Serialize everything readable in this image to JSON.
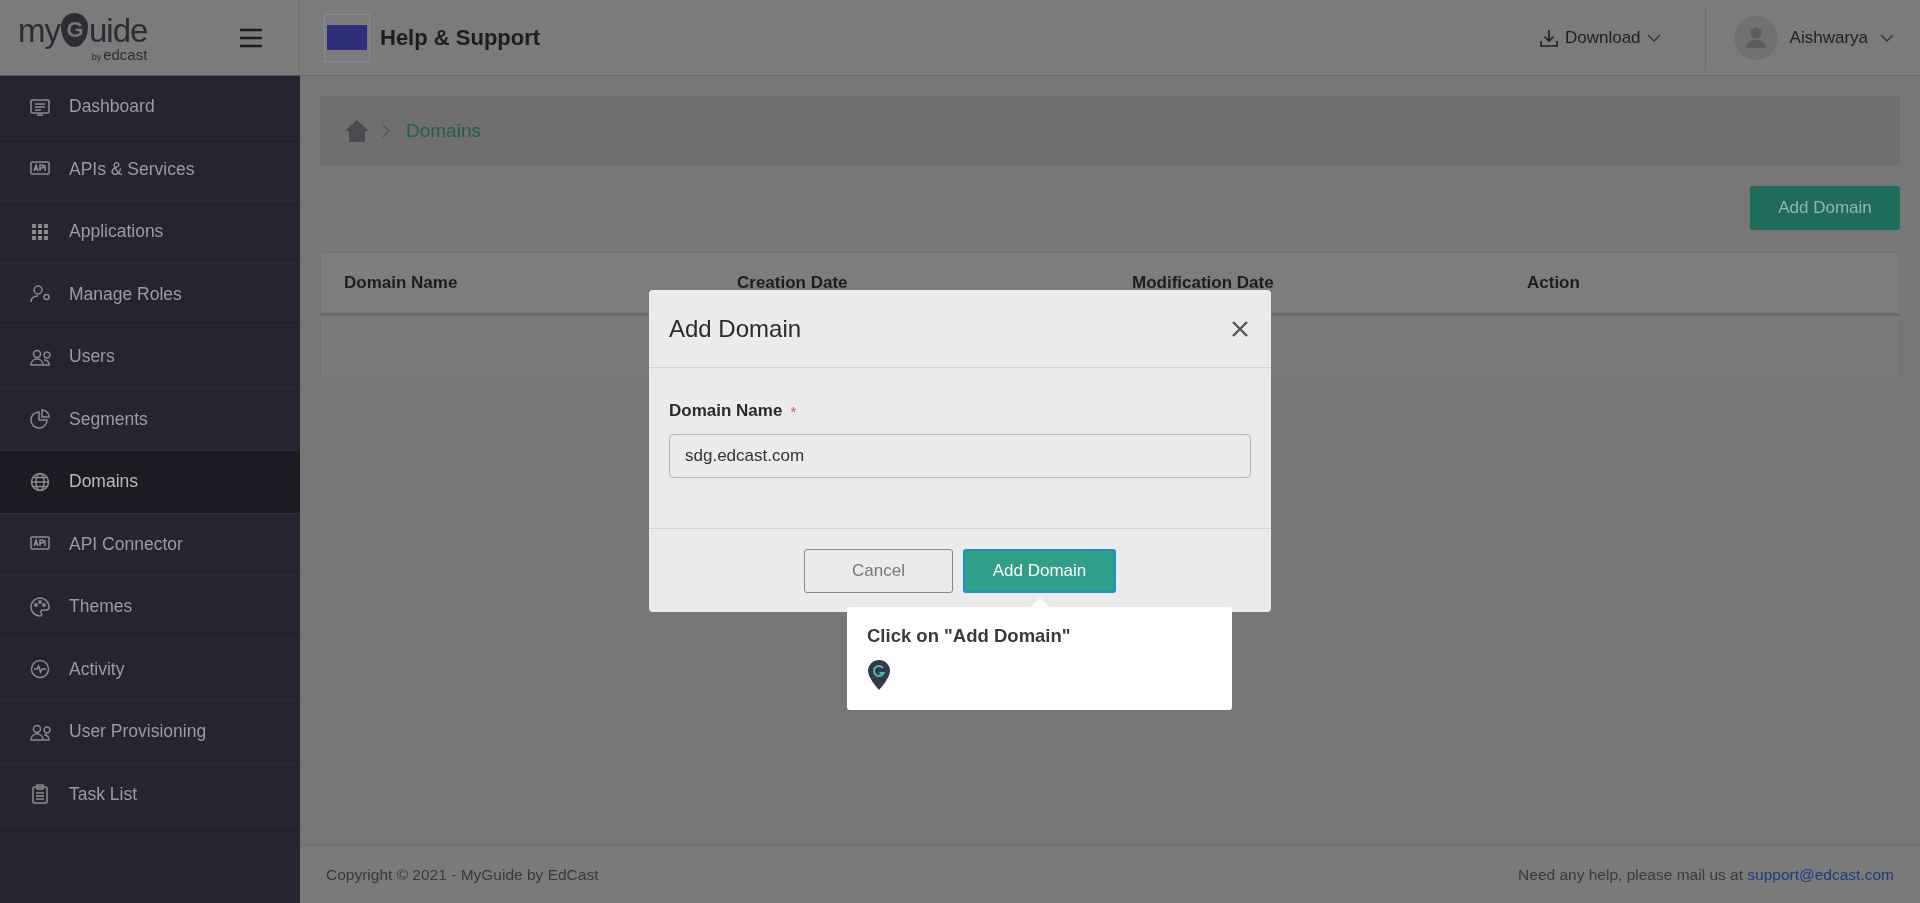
{
  "logo": {
    "prefix": "my",
    "pin_letter": "G",
    "suffix": "uide",
    "by": "by",
    "brand": "edcast"
  },
  "header": {
    "title": "Help & Support",
    "download": "Download",
    "user": "Aishwarya"
  },
  "sidebar": {
    "items": [
      {
        "label": "Dashboard",
        "selected": false
      },
      {
        "label": "APIs & Services",
        "selected": false
      },
      {
        "label": "Applications",
        "selected": false
      },
      {
        "label": "Manage Roles",
        "selected": false
      },
      {
        "label": "Users",
        "selected": false
      },
      {
        "label": "Segments",
        "selected": false
      },
      {
        "label": "Domains",
        "selected": true
      },
      {
        "label": "API Connector",
        "selected": false
      },
      {
        "label": "Themes",
        "selected": false
      },
      {
        "label": "Activity",
        "selected": false
      },
      {
        "label": "User Provisioning",
        "selected": false
      },
      {
        "label": "Task List",
        "selected": false
      }
    ]
  },
  "breadcrumb": {
    "current": "Domains"
  },
  "add_button": "Add Domain",
  "table": {
    "columns": [
      "Domain Name",
      "Creation Date",
      "Modification Date",
      "Action"
    ]
  },
  "modal": {
    "title": "Add Domain",
    "field_label": "Domain Name",
    "required": "*",
    "value": "sdg.edcast.com",
    "buttons": [
      {
        "label": "Cancel",
        "kind": "secondary"
      },
      {
        "label": "Add Domain",
        "kind": "primary"
      }
    ]
  },
  "tooltip": {
    "text": "Click on \"Add Domain\""
  },
  "footer": {
    "copyright": "Copyright © 2021 - MyGuide by EdCast",
    "help": "Need any help, please mail us at",
    "email": "support@edcast.com"
  }
}
